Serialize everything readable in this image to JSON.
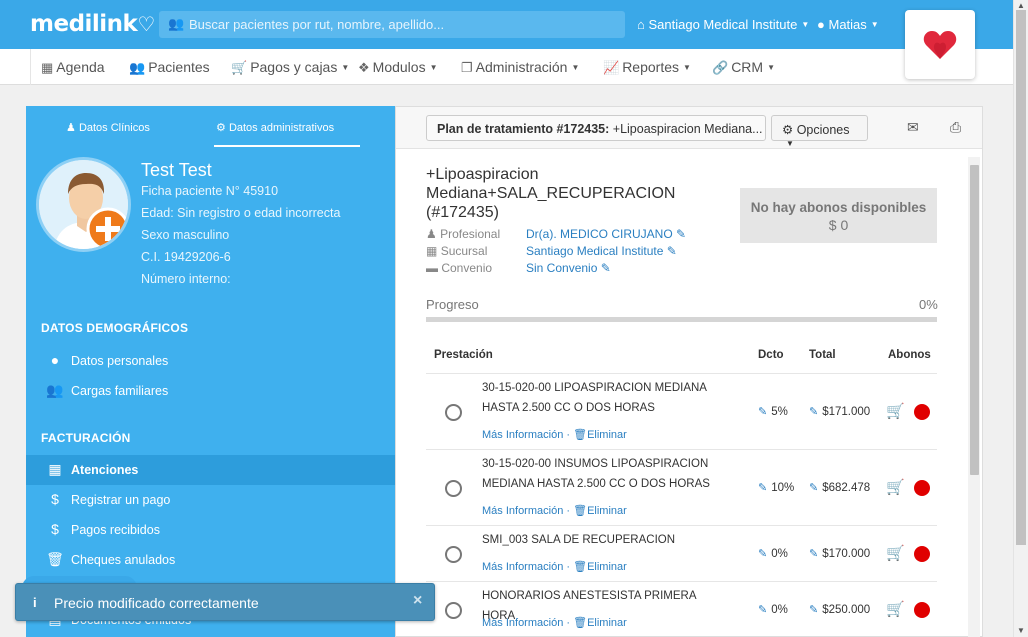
{
  "app": {
    "logo_text": "medilink"
  },
  "topbar": {
    "search_placeholder": "Buscar pacientes por rut, nombre, apellido...",
    "clinic_label": "Santiago Medical Institute",
    "user_label": "Matias"
  },
  "nav": [
    {
      "label": "Agenda",
      "icon": "calendar-icon"
    },
    {
      "label": "Pacientes",
      "icon": "users-icon"
    },
    {
      "label": "Pagos y cajas",
      "icon": "cart-icon"
    },
    {
      "label": "Modulos",
      "icon": "cubes-icon"
    },
    {
      "label": "Administración",
      "icon": "copy-icon"
    },
    {
      "label": "Reportes",
      "icon": "chart-icon"
    },
    {
      "label": "CRM",
      "icon": "link-icon"
    }
  ],
  "sidebar": {
    "tabs": [
      "Datos Clínicos",
      "Datos administrativos"
    ],
    "patient": {
      "name": "Test Test",
      "ficha": "Ficha paciente N° 45910",
      "edad": "Edad: Sin registro o edad incorrecta",
      "sexo": "Sexo masculino",
      "ci": "C.I. 19429206-6",
      "interno": "Número interno:"
    },
    "section_demograficos": "DATOS DEMOGRÁFICOS",
    "demograficos": [
      "Datos personales",
      "Cargas familiares"
    ],
    "section_facturacion": "FACTURACIÓN",
    "facturacion": [
      "Atenciones",
      "Registrar un pago",
      "Pagos recibidos",
      "Cheques anulados",
      "Documentos emitidos"
    ]
  },
  "plan": {
    "button_prefix": "Plan de tratamiento #172435:",
    "button_name": "+Lipoaspiracion Mediana...",
    "options_label": "Opciones",
    "title": "+Lipoaspiracion Mediana+SALA_RECUPERACION (#172435)",
    "meta": [
      {
        "label": "Profesional",
        "value": "Dr(a). MEDICO CIRUJANO"
      },
      {
        "label": "Sucursal",
        "value": "Santiago Medical Institute"
      },
      {
        "label": "Convenio",
        "value": "Sin Convenio"
      }
    ],
    "abonos_title": "No hay abonos disponibles",
    "abonos_amount": "$ 0",
    "progress_label": "Progreso",
    "progress_text": "0%",
    "progress_fraction": 0,
    "columns": {
      "prestacion": "Prestación",
      "dcto": "Dcto",
      "total": "Total",
      "abonos": "Abonos"
    },
    "more_info": "Más Información",
    "delete": "Eliminar",
    "rows": [
      {
        "line1": "30-15-020-00 LIPOASPIRACION MEDIANA",
        "line2": "HASTA 2.500 CC O DOS HORAS",
        "dcto": "5%",
        "total": "$171.000"
      },
      {
        "line1": "30-15-020-00 INSUMOS LIPOASPIRACION",
        "line2": "MEDIANA HASTA 2.500 CC O DOS HORAS",
        "dcto": "10%",
        "total": "$682.478"
      },
      {
        "line1": "SMI_003 SALA DE RECUPERACION",
        "line2": "",
        "dcto": "0%",
        "total": "$170.000"
      },
      {
        "line1": "HONORARIOS ANESTESISTA PRIMERA HORA",
        "line2": "",
        "dcto": "0%",
        "total": "$250.000"
      }
    ]
  },
  "toast": {
    "message": "Precio modificado correctamente"
  },
  "colors": {
    "primary": "#3aa8e8",
    "sidebar": "#3fb0ee",
    "danger": "#e00000",
    "link": "#2a7fc1"
  }
}
